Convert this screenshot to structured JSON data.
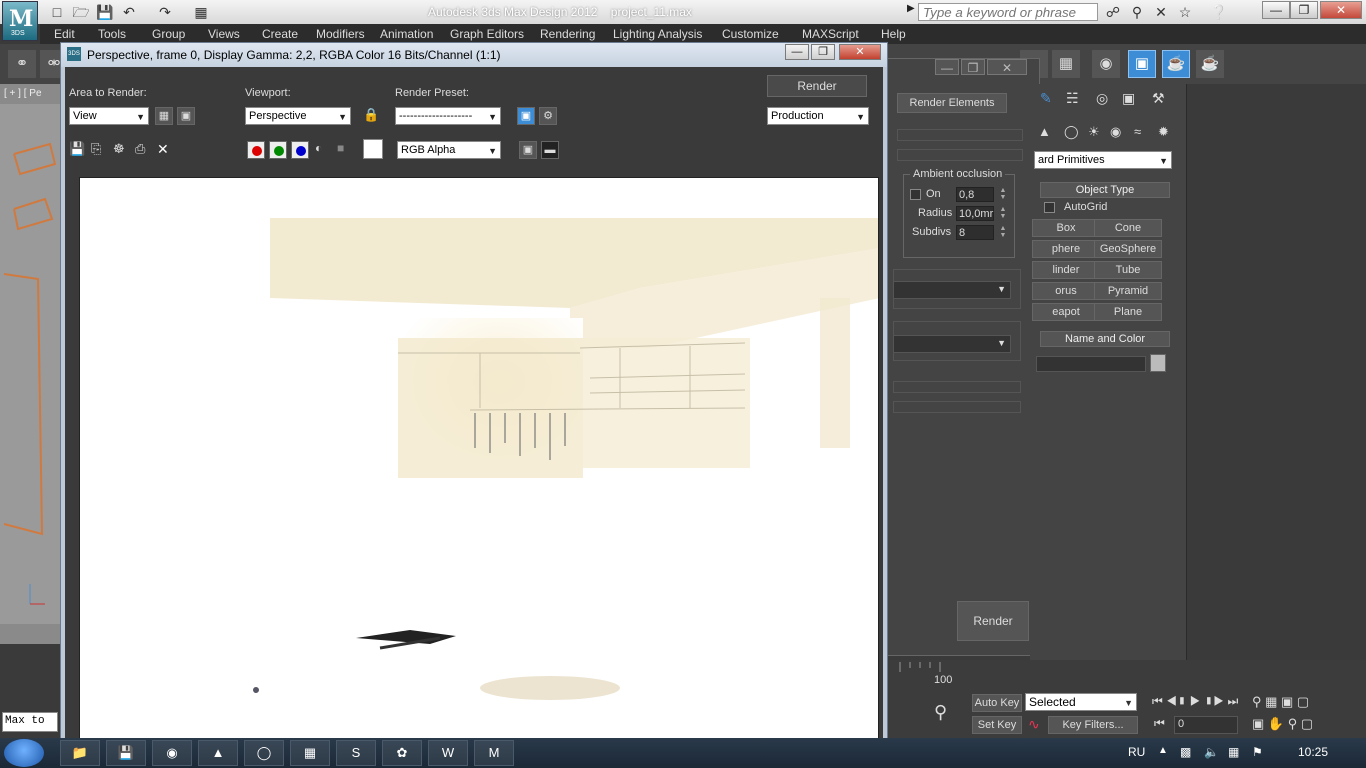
{
  "app": {
    "title": "Autodesk 3ds Max Design 2012",
    "file": "project_11.max",
    "logo_text": "M",
    "logo_sub": "3DS",
    "search_placeholder": "Type a keyword or phrase"
  },
  "menu": [
    "Edit",
    "Tools",
    "Group",
    "Views",
    "Create",
    "Modifiers",
    "Animation",
    "Graph Editors",
    "Rendering",
    "Lighting Analysis",
    "Customize",
    "MAXScript",
    "Help"
  ],
  "frame_buffer": {
    "title": "Perspective, frame 0, Display Gamma: 2,2, RGBA Color 16 Bits/Channel (1:1)",
    "area_label": "Area to Render:",
    "area_value": "View",
    "viewport_label": "Viewport:",
    "viewport_value": "Perspective",
    "preset_label": "Render Preset:",
    "preset_value": "--------------------",
    "render_button": "Render",
    "mode_value": "Production",
    "channel_value": "RGB Alpha"
  },
  "render_setup": {
    "tab": "Render Elements",
    "ao_title": "Ambient occlusion",
    "ao_on_label": "On",
    "ao_on_value": "0,8",
    "radius_label": "Radius",
    "radius_value": "10,0mr",
    "subdivs_label": "Subdivs",
    "subdivs_value": "8",
    "render_button": "Render"
  },
  "command_panel": {
    "category": "ard Primitives",
    "object_type_header": "Object Type",
    "autogrid_label": "AutoGrid",
    "buttons": [
      "Box",
      "Cone",
      "phere",
      "GeoSphere",
      "linder",
      "Tube",
      "orus",
      "Pyramid",
      "eapot",
      "Plane"
    ],
    "name_color_header": "Name and Color"
  },
  "status": {
    "auto_key": "Auto Key",
    "set_key": "Set Key",
    "selected": "Selected",
    "key_filters": "Key Filters...",
    "frame_value": "0",
    "timeline_end": "100",
    "maxscript": "Max to"
  },
  "viewport_label": "[ + ] [ Pe",
  "taskbar": {
    "lang": "RU",
    "time": "10:25"
  }
}
